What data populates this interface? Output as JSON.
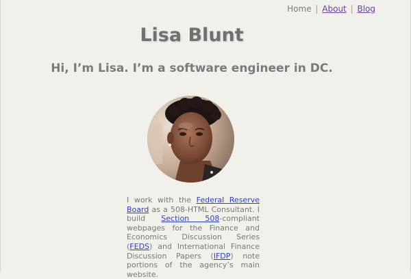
{
  "nav": {
    "home_label": "Home",
    "separator": "|",
    "about_label": "About",
    "blog_label": "Blog"
  },
  "header": {
    "title": "Lisa Blunt",
    "tagline": "Hi, I’m Lisa. I’m a software engineer in DC."
  },
  "bio": {
    "text_1": "I work with the ",
    "link_frb": "Federal Reserve Board",
    "text_2": " as a 508-HTML Consultant. I build ",
    "link_508": "Section 508",
    "text_3": "-compliant webpages for the Finance and Economics Discussion Series (",
    "link_feds": "FEDS",
    "text_4": ") and International Finance Discussion Papers (",
    "link_ifdp": "IFDP",
    "text_5": ") note portions of the agency’s main website."
  },
  "colors": {
    "background": "#f1f1ec",
    "text": "#777777",
    "visited_link": "#6b3fa0",
    "link": "#2a3fc8"
  },
  "icons": {
    "avatar": "profile-photo"
  }
}
